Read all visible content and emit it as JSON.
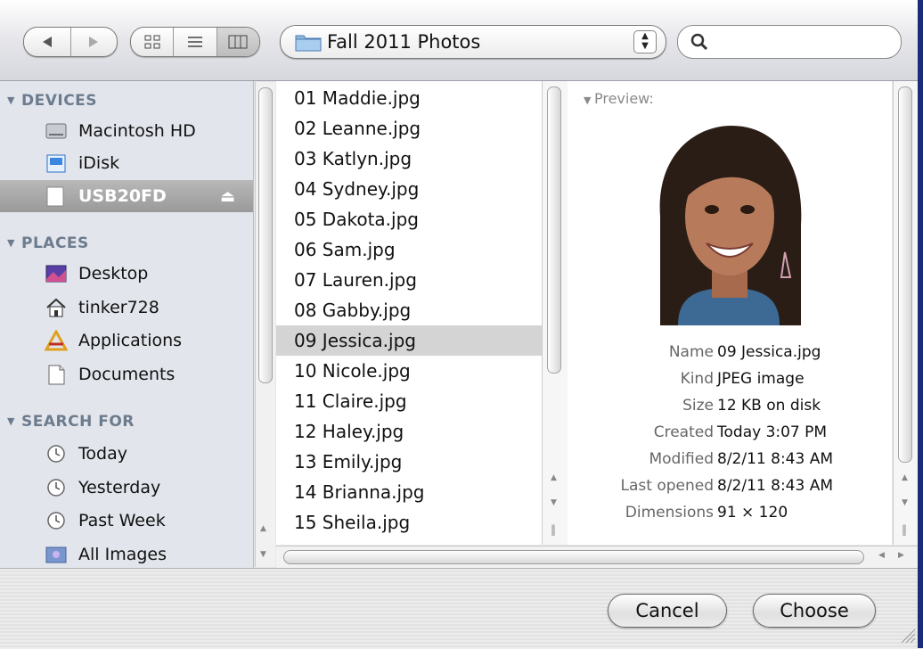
{
  "toolbar": {
    "folder_name": "Fall 2011 Photos",
    "search_placeholder": ""
  },
  "sidebar": {
    "devices_header": "DEVICES",
    "devices": [
      {
        "label": "Macintosh HD",
        "icon": "hard-drive-icon"
      },
      {
        "label": "iDisk",
        "icon": "idisk-icon"
      },
      {
        "label": "USB20FD",
        "icon": "usb-drive-icon",
        "selected": true
      }
    ],
    "places_header": "PLACES",
    "places": [
      {
        "label": "Desktop",
        "icon": "desktop-icon"
      },
      {
        "label": "tinker728",
        "icon": "home-icon"
      },
      {
        "label": "Applications",
        "icon": "applications-icon"
      },
      {
        "label": "Documents",
        "icon": "documents-icon"
      }
    ],
    "search_header": "SEARCH FOR",
    "searches": [
      {
        "label": "Today",
        "icon": "clock-icon"
      },
      {
        "label": "Yesterday",
        "icon": "clock-icon"
      },
      {
        "label": "Past Week",
        "icon": "clock-icon"
      },
      {
        "label": "All Images",
        "icon": "images-folder-icon"
      }
    ]
  },
  "files": [
    "01 Maddie.jpg",
    "02 Leanne.jpg",
    "03 Katlyn.jpg",
    "04 Sydney.jpg",
    "05 Dakota.jpg",
    "06 Sam.jpg",
    "07 Lauren.jpg",
    "08 Gabby.jpg",
    "09 Jessica.jpg",
    "10 Nicole.jpg",
    "11 Claire.jpg",
    "12 Haley.jpg",
    "13 Emily.jpg",
    "14 Brianna.jpg",
    "15 Sheila.jpg"
  ],
  "selected_file": "09 Jessica.jpg",
  "preview": {
    "header": "Preview:",
    "info": [
      {
        "key": "Name",
        "value": "09 Jessica.jpg"
      },
      {
        "key": "Kind",
        "value": "JPEG image"
      },
      {
        "key": "Size",
        "value": "12 KB on disk"
      },
      {
        "key": "Created",
        "value": "Today 3:07 PM"
      },
      {
        "key": "Modified",
        "value": "8/2/11 8:43 AM"
      },
      {
        "key": "Last opened",
        "value": "8/2/11 8:43 AM"
      },
      {
        "key": "Dimensions",
        "value": "91 × 120"
      }
    ]
  },
  "buttons": {
    "cancel": "Cancel",
    "choose": "Choose"
  },
  "colors": {
    "accent": "#6d7b8e",
    "selection": "#d4d4d4",
    "sidebar_bg": "#e2e6ec"
  }
}
